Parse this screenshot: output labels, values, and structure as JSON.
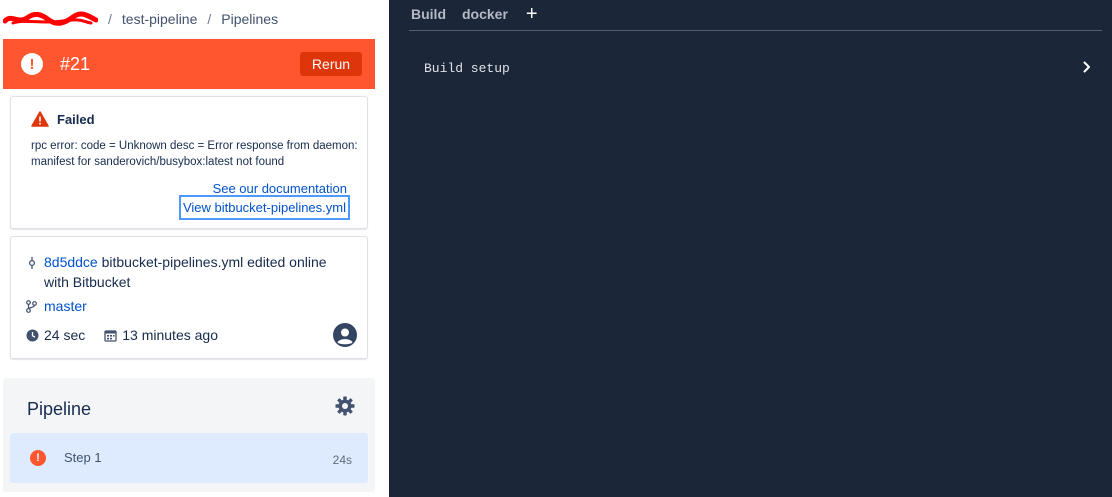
{
  "breadcrumb": {
    "items": [
      "test-pipeline",
      "Pipelines"
    ],
    "separator": "/"
  },
  "status": {
    "run_number": "#21",
    "rerun_label": "Rerun",
    "color": "#ff5630"
  },
  "error": {
    "title": "Failed",
    "message": "rpc error: code = Unknown desc = Error response from daemon: manifest for sanderovich/busybox:latest not found",
    "doc_link": "See our documentation",
    "yml_link": "View bitbucket-pipelines.yml"
  },
  "commit": {
    "hash": "8d5ddce",
    "message": "bitbucket-pipelines.yml edited online with Bitbucket",
    "branch": "master",
    "duration": "24 sec",
    "time_ago": "13 minutes ago"
  },
  "pipeline": {
    "title": "Pipeline",
    "steps": [
      {
        "name": "Step 1",
        "duration": "24s",
        "status": "failed"
      }
    ]
  },
  "log_panel": {
    "tabs": [
      "Build",
      "docker"
    ],
    "add_label": "+",
    "lines": [
      "Build setup"
    ],
    "background": "#1b2638"
  },
  "icons": [
    "error-icon",
    "warning-icon",
    "commit-icon",
    "branch-icon",
    "clock-icon",
    "calendar-icon",
    "avatar-icon",
    "gear-icon",
    "chevron-right-icon"
  ]
}
